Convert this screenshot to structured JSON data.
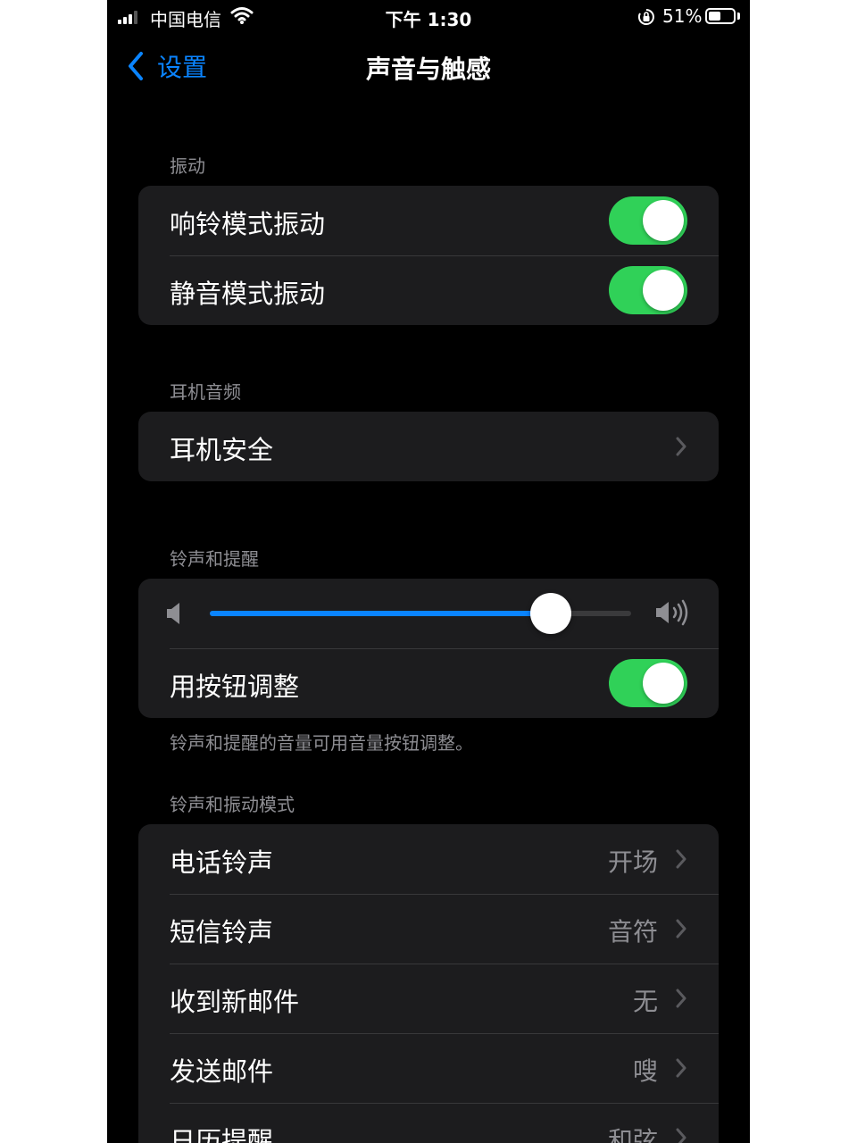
{
  "status_bar": {
    "carrier": "中国电信",
    "time": "下午 1:30",
    "battery_percent": "51%",
    "battery_level": 0.51,
    "signal_bars": 3
  },
  "nav": {
    "back_label": "设置",
    "title": "声音与触感"
  },
  "vibration": {
    "header": "振动",
    "items": [
      {
        "label": "响铃模式振动",
        "on": true
      },
      {
        "label": "静音模式振动",
        "on": true
      }
    ]
  },
  "headphone_audio": {
    "header": "耳机音频",
    "items": [
      {
        "label": "耳机安全"
      }
    ]
  },
  "ringer_alerts": {
    "header": "铃声和提醒",
    "volume": 0.81,
    "change_with_buttons": {
      "label": "用按钮调整",
      "on": true
    },
    "footer": "铃声和提醒的音量可用音量按钮调整。"
  },
  "sounds_patterns": {
    "header": "铃声和振动模式",
    "items": [
      {
        "label": "电话铃声",
        "value": "开场"
      },
      {
        "label": "短信铃声",
        "value": "音符"
      },
      {
        "label": "收到新邮件",
        "value": "无"
      },
      {
        "label": "发送邮件",
        "value": "嗖"
      },
      {
        "label": "日历提醒",
        "value": "和弦"
      }
    ]
  },
  "colors": {
    "accent": "#0a84ff",
    "toggle_on": "#30d158",
    "background": "#000000",
    "cell": "#1c1c1e",
    "secondary_text": "#8e8e93"
  }
}
